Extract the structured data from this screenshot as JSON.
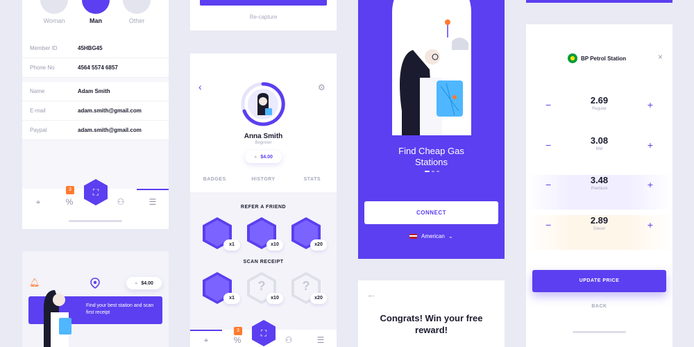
{
  "profile": {
    "genders": [
      {
        "label": "Woman",
        "selected": false
      },
      {
        "label": "Man",
        "selected": true
      },
      {
        "label": "Other",
        "selected": false
      }
    ],
    "member_rows": [
      {
        "key": "Member ID",
        "value": "45HBG45"
      },
      {
        "key": "Phone No",
        "value": "4564 5574 6857"
      }
    ],
    "user_rows": [
      {
        "key": "Name",
        "value": "Adam Smith"
      },
      {
        "key": "E-mail",
        "value": "adam.smith@gmail.com"
      },
      {
        "key": "Paypal",
        "value": "adam.smith@gmail.com"
      }
    ],
    "nav_badge": "3"
  },
  "home": {
    "balance": "$4.00",
    "promo_text": "Find your best station and scan first receipt"
  },
  "capture": {
    "recapture": "Re-capture"
  },
  "user_profile": {
    "name": "Anna Smith",
    "level": "Beginner",
    "balance": "$4.00",
    "tabs": [
      "BADGES",
      "HISTORY",
      "STATS"
    ]
  },
  "badges": {
    "refer_title": "REFER A FRIEND",
    "scan_title": "SCAN RECEIPT",
    "refer": [
      {
        "mult": "x1",
        "unlocked": true
      },
      {
        "mult": "x10",
        "unlocked": true
      },
      {
        "mult": "x20",
        "unlocked": true
      }
    ],
    "scan": [
      {
        "mult": "x1",
        "unlocked": true
      },
      {
        "mult": "x10",
        "unlocked": false
      },
      {
        "mult": "x20",
        "unlocked": false
      }
    ],
    "nav_badge": "3"
  },
  "onboarding": {
    "title_line1": "Find Cheap Gas",
    "title_line2": "Stations",
    "connect": "CONNECT",
    "language": "American"
  },
  "reward": {
    "line1": "Congrats! Win your free",
    "line2": "reward!"
  },
  "station": {
    "name": "BP Petrol Station",
    "prices": [
      {
        "value": "2.69",
        "label": "Regular"
      },
      {
        "value": "3.08",
        "label": "Mid"
      },
      {
        "value": "3.48",
        "label": "Premium"
      },
      {
        "value": "2.89",
        "label": "Diesel"
      }
    ],
    "update": "UPDATE PRICE",
    "back": "BACK"
  },
  "colors": {
    "accent": "#5b3ff0",
    "badge": "#ff7a2f",
    "background": "#e9eaf3"
  }
}
